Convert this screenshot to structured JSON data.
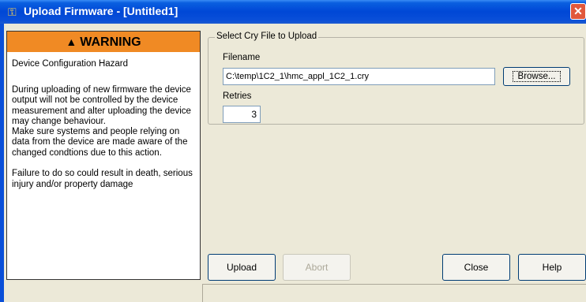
{
  "window": {
    "title": "Upload Firmware - [Untitled1]",
    "close_glyph": "✕",
    "icon": "firmware-icon"
  },
  "warning": {
    "header": "WARNING",
    "header_icon": "warning-triangle-icon",
    "title": "Device Configuration Hazard",
    "body": "During uploading of new firmware the device output will not be controlled by the device measurement and alter uploading the device may change behaviour.\nMake sure systems and people relying on data from the device are made aware of the changed condtions due to this action.\n\nFailure to do so could result in death, serious injury and/or property damage",
    "header_color": "#f08a24"
  },
  "file_group": {
    "legend": "Select Cry File to Upload",
    "filename_label": "Filename",
    "filename_value": "C:\\temp\\1C2_1\\hmc_appl_1C2_1.cry",
    "browse_label": "Browse...",
    "retries_label": "Retries",
    "retries_value": "3"
  },
  "buttons": {
    "upload": "Upload",
    "abort": "Abort",
    "close": "Close",
    "help": "Help"
  }
}
